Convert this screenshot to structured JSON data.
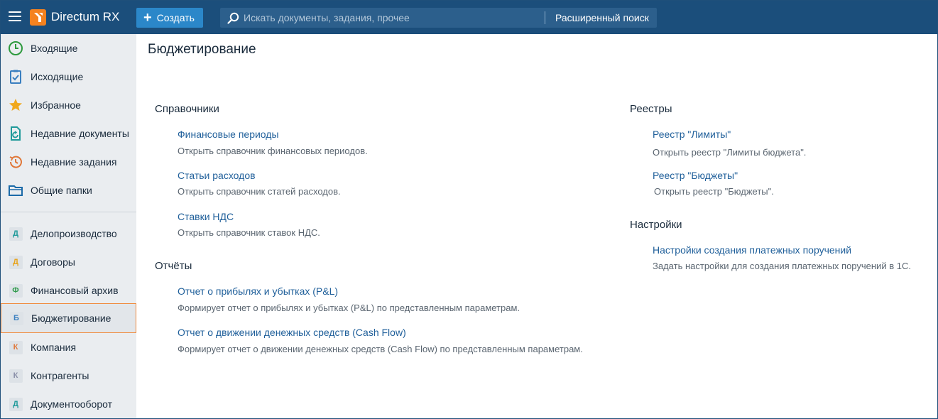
{
  "header": {
    "app_name": "Directum RX",
    "create_label": "Создать",
    "search_placeholder": "Искать документы, задания, прочее",
    "advanced_search": "Расширенный поиск"
  },
  "sidebar": {
    "items": [
      {
        "label": "Входящие",
        "icon": "clock-icon"
      },
      {
        "label": "Исходящие",
        "icon": "checklist-icon"
      },
      {
        "label": "Избранное",
        "icon": "star-icon"
      },
      {
        "label": "Недавние документы",
        "icon": "document-refresh-icon"
      },
      {
        "label": "Недавние задания",
        "icon": "history-icon"
      },
      {
        "label": "Общие папки",
        "icon": "folder-icon"
      }
    ],
    "modules": [
      {
        "letter": "Д",
        "label": "Делопроизводство",
        "color": "#1f9a9a"
      },
      {
        "letter": "Д",
        "label": "Договоры",
        "color": "#e8a319"
      },
      {
        "letter": "Ф",
        "label": "Финансовый архив",
        "color": "#2e9a4a"
      },
      {
        "letter": "Б",
        "label": "Бюджетирование",
        "color": "#3a7fc0"
      },
      {
        "letter": "К",
        "label": "Компания",
        "color": "#e0783a"
      },
      {
        "letter": "К",
        "label": "Контрагенты",
        "color": "#8a8fa8"
      },
      {
        "letter": "Д",
        "label": "Документооборот",
        "color": "#1f9a9a"
      }
    ]
  },
  "main": {
    "title": "Бюджетирование",
    "left": {
      "references": {
        "title": "Справочники",
        "items": [
          {
            "link": "Финансовые периоды",
            "desc": "Открыть справочник финансовых периодов."
          },
          {
            "link": "Статьи расходов",
            "desc": "Открыть справочник статей расходов."
          },
          {
            "link": "Ставки НДС",
            "desc": "Открыть справочник ставок НДС."
          }
        ]
      },
      "reports": {
        "title": "Отчёты",
        "items": [
          {
            "link": "Отчет о прибылях и убытках (P&L)",
            "desc": "Формирует отчет о прибылях и убытках (P&L) по представленным параметрам."
          },
          {
            "link": "Отчет о движении денежных средств (Cash Flow)",
            "desc": "Формирует отчет о движении денежных средств (Cash Flow) по представленным параметрам."
          }
        ]
      }
    },
    "right": {
      "registers": {
        "title": "Реестры",
        "items": [
          {
            "link": "Реестр \"Лимиты\"",
            "desc": "Открыть  реестр \"Лимиты бюджета\"."
          },
          {
            "link": "Реестр \"Бюджеты\"",
            "desc": "Открыть  реестр \"Бюджеты\"."
          }
        ]
      },
      "settings": {
        "title": "Настройки",
        "items": [
          {
            "link": "Настройки создания платежных поручений",
            "desc": "Задать настройки для создания платежных поручений в 1С."
          }
        ]
      }
    }
  }
}
